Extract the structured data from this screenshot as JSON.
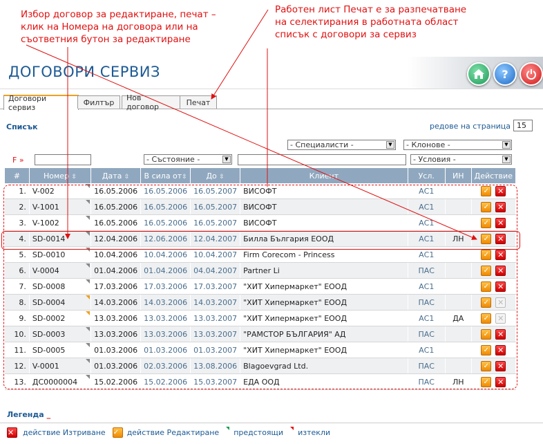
{
  "annotations": {
    "left_note": [
      "Избор договор за редактиране, печат –",
      "клик на Номера на договора или на",
      "съответния бутон за редактиране"
    ],
    "right_note": [
      "Работен лист Печат е за разпечатване",
      "на селектирания в работната област",
      "списък с договори за сервиз"
    ]
  },
  "header": {
    "title": "ДОГОВОРИ СЕРВИЗ",
    "home_icon": "home-icon",
    "help_icon": "help-icon",
    "power_icon": "power-icon",
    "help_label": "?"
  },
  "tabs": [
    "Договори сервиз",
    "Филтър",
    "Нов договор",
    "Печат"
  ],
  "list": {
    "label": "Списък",
    "rows_per_page_label": "редове на страница »",
    "rows_per_page": "15"
  },
  "filters": {
    "specialists": "- Специалисти -",
    "branches": "- Клонове -",
    "state": "- Състояние -",
    "conditions": "- Условия -",
    "f_label": "F »"
  },
  "columns": [
    "#",
    "Номер",
    "Дата",
    "В сила от",
    "До",
    "Клиент",
    "Усл.",
    "ИН",
    "Действие"
  ],
  "rows": [
    {
      "idx": "1.",
      "num": "V-002",
      "date": "16.05.2006",
      "from": "16.05.2006",
      "to": "16.05.2007",
      "client": "ВИСОФТ",
      "usl": "АС1",
      "in": "",
      "corner": "gray",
      "del": true
    },
    {
      "idx": "2.",
      "num": "V-1001",
      "date": "16.05.2006",
      "from": "16.05.2006",
      "to": "16.05.2007",
      "client": "ВИСОФТ",
      "usl": "АС1",
      "in": "",
      "corner": "gray",
      "del": true
    },
    {
      "idx": "3.",
      "num": "V-1002",
      "date": "16.05.2006",
      "from": "16.05.2006",
      "to": "16.05.2007",
      "client": "ВИСОФТ",
      "usl": "АС1",
      "in": "",
      "corner": "gray",
      "del": true
    },
    {
      "idx": "4.",
      "num": "SD-0014",
      "date": "12.04.2006",
      "from": "12.06.2006",
      "to": "12.04.2007",
      "client": "Билла България ЕООД",
      "usl": "АС1",
      "in": "ЛН",
      "corner": "gray",
      "del": true
    },
    {
      "idx": "5.",
      "num": "SD-0010",
      "date": "10.04.2006",
      "from": "10.04.2006",
      "to": "10.04.2007",
      "client": "Firm Corecom - Princess",
      "usl": "АС1",
      "in": "",
      "corner": "gray",
      "del": true
    },
    {
      "idx": "6.",
      "num": "V-0004",
      "date": "01.04.2006",
      "from": "01.04.2006",
      "to": "04.04.2007",
      "client": "Partner Li",
      "usl": "ПАС",
      "in": "",
      "corner": "gray",
      "del": true
    },
    {
      "idx": "7.",
      "num": "SD-0008",
      "date": "17.03.2006",
      "from": "17.03.2006",
      "to": "17.03.2007",
      "client": "\"ХИТ Хипермаркет\" ЕООД",
      "usl": "АС1",
      "in": "",
      "corner": "gray",
      "del": true
    },
    {
      "idx": "8.",
      "num": "SD-0004",
      "date": "14.03.2006",
      "from": "14.03.2006",
      "to": "14.03.2007",
      "client": "\"ХИТ Хипермаркет\" ЕООД",
      "usl": "ПАС",
      "in": "",
      "corner": "orange",
      "del": false
    },
    {
      "idx": "9.",
      "num": "SD-0002",
      "date": "13.03.2006",
      "from": "13.03.2006",
      "to": "13.03.2007",
      "client": "\"ХИТ Хипермаркет\" ЕООД",
      "usl": "АС1",
      "in": "ДА",
      "corner": "orange",
      "del": false
    },
    {
      "idx": "10.",
      "num": "SD-0003",
      "date": "13.03.2006",
      "from": "13.03.2006",
      "to": "13.03.2007",
      "client": "\"РАМСТОР БЪЛГАРИЯ\" АД",
      "usl": "ПАС",
      "in": "",
      "corner": "gray",
      "del": true
    },
    {
      "idx": "11.",
      "num": "SD-0005",
      "date": "01.03.2006",
      "from": "01.03.2006",
      "to": "01.03.2007",
      "client": "\"ХИТ Хипермаркет\" ЕООД",
      "usl": "АС1",
      "in": "",
      "corner": "gray",
      "del": true
    },
    {
      "idx": "12.",
      "num": "V-0001",
      "date": "01.03.2006",
      "from": "02.03.2006",
      "to": "13.08.2006",
      "client": "Blagoevgrad Ltd.",
      "usl": "ПАС",
      "in": "",
      "corner": "gray",
      "del": true
    },
    {
      "idx": "13.",
      "num": "ДС0000004",
      "date": "15.02.2006",
      "from": "15.02.2006",
      "to": "15.03.2007",
      "client": "ЕДА ООД",
      "usl": "ПАС",
      "in": "ЛН",
      "corner": "gray",
      "del": true
    }
  ],
  "legend": {
    "title": "Легенда",
    "delete_label": "действие Изтриване",
    "edit_label": "действие Редактиране",
    "upcoming_label": "предстоящи",
    "expired_label": "изтекли"
  },
  "colors": {
    "accent": "#1c5a94",
    "header_row": "#90a8bf",
    "annotation": "#e01010",
    "edit": "#f08a00",
    "delete": "#d00000"
  }
}
